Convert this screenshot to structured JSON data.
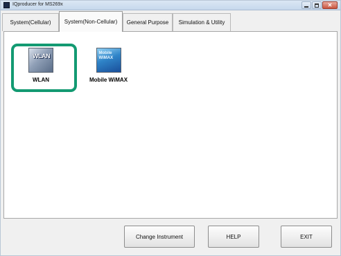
{
  "window": {
    "title": "IQproducer for MS269x"
  },
  "tabs": [
    {
      "label": "System(Cellular)",
      "active": false
    },
    {
      "label": "System(Non-Cellular)",
      "active": true
    },
    {
      "label": "General Purpose",
      "active": false
    },
    {
      "label": "Simulation & Utility",
      "active": false
    }
  ],
  "apps": [
    {
      "label": "WLAN",
      "icon_text": "WLAN",
      "icon": "wlan-icon",
      "highlighted": true
    },
    {
      "label": "Mobile WiMAX",
      "icon_text": "Mobile",
      "icon_text2": "WiMAX",
      "icon": "wimax-icon",
      "highlighted": false
    }
  ],
  "buttons": {
    "change_instrument": "Change Instrument",
    "help": "HELP",
    "exit": "EXIT"
  },
  "colors": {
    "highlight": "#139a72"
  }
}
